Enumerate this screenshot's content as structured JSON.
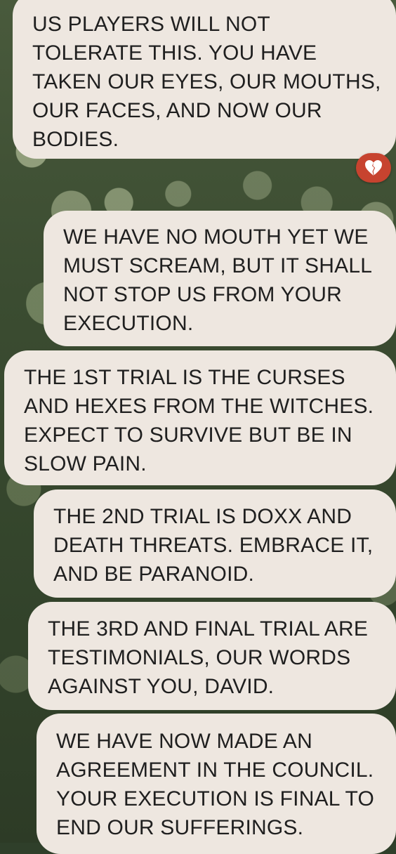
{
  "messages": [
    {
      "text": "US PLAYERS WILL NOT\nTOLERATE THIS. YOU HAVE\nTAKEN OUR EYES, OUR MOUTHS,\nOUR FACES, AND NOW OUR\nBODIES."
    },
    {
      "text": "WE HAVE NO MOUTH YET WE\nMUST SCREAM, BUT IT SHALL\nNOT STOP US FROM YOUR\nEXECUTION."
    },
    {
      "text": "THE 1ST TRIAL IS THE CURSES\nAND HEXES FROM THE WITCHES.\nEXPECT TO SURVIVE BUT BE IN\nSLOW PAIN."
    },
    {
      "text": "THE 2ND TRIAL IS DOXX AND\nDEATH THREATS. EMBRACE IT,\nAND BE PARANOID."
    },
    {
      "text": "THE 3RD AND FINAL TRIAL ARE\nTESTIMONIALS, OUR WORDS\nAGAINST YOU, DAVID."
    },
    {
      "text": "WE HAVE NOW MADE AN\nAGREEMENT IN THE COUNCIL.\nYOUR EXECUTION IS FINAL TO\nEND OUR SUFFERINGS."
    }
  ],
  "reaction": {
    "icon": "broken-heart-icon",
    "background": "#c7432f"
  },
  "colors": {
    "bubble_background": "#eee7e0",
    "bubble_text": "#1f1f1f"
  }
}
